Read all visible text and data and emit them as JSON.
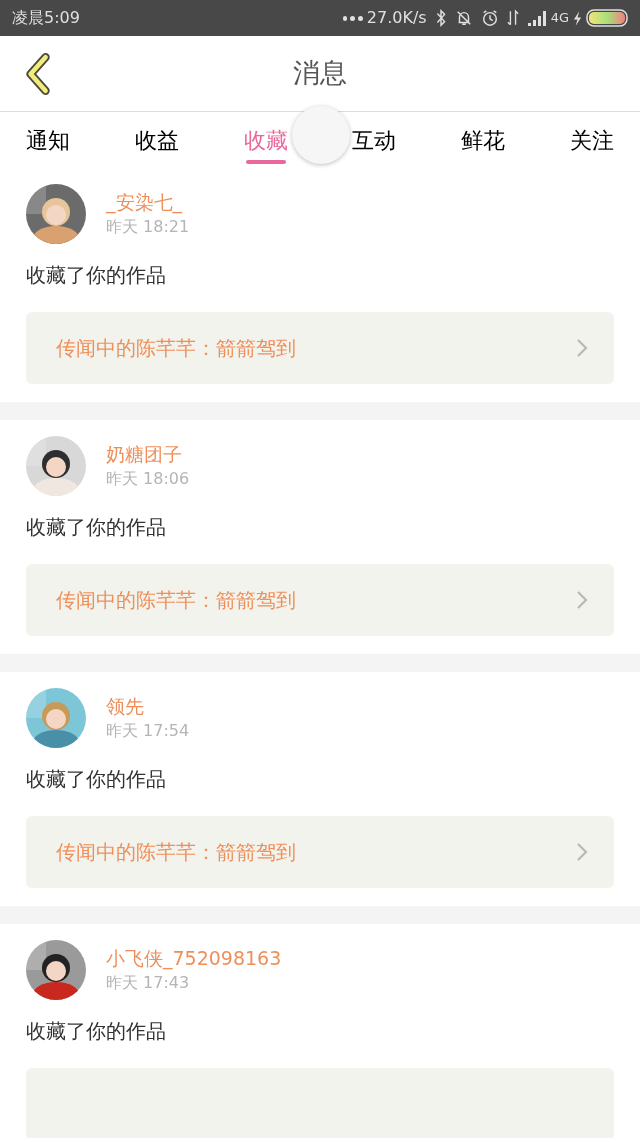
{
  "status_bar": {
    "time": "凌晨5:09",
    "speed": "27.0K/s",
    "network": "4G"
  },
  "header": {
    "title": "消息"
  },
  "tabs": [
    {
      "label": "通知",
      "selected": false
    },
    {
      "label": "收益",
      "selected": false
    },
    {
      "label": "收藏",
      "selected": true
    },
    {
      "label": "互动",
      "selected": false
    },
    {
      "label": "鲜花",
      "selected": false
    },
    {
      "label": "关注",
      "selected": false
    }
  ],
  "messages": [
    {
      "name": "_安染七_",
      "time": "昨天 18:21",
      "text": "收藏了你的作品",
      "link": "传闻中的陈芊芊：箭箭驾到"
    },
    {
      "name": "奶糖团子",
      "time": "昨天 18:06",
      "text": "收藏了你的作品",
      "link": "传闻中的陈芊芊：箭箭驾到"
    },
    {
      "name": "领先",
      "time": "昨天 17:54",
      "text": "收藏了你的作品",
      "link": "传闻中的陈芊芊：箭箭驾到"
    },
    {
      "name": "小飞侠_752098163",
      "time": "昨天 17:43",
      "text": "收藏了你的作品"
    }
  ]
}
